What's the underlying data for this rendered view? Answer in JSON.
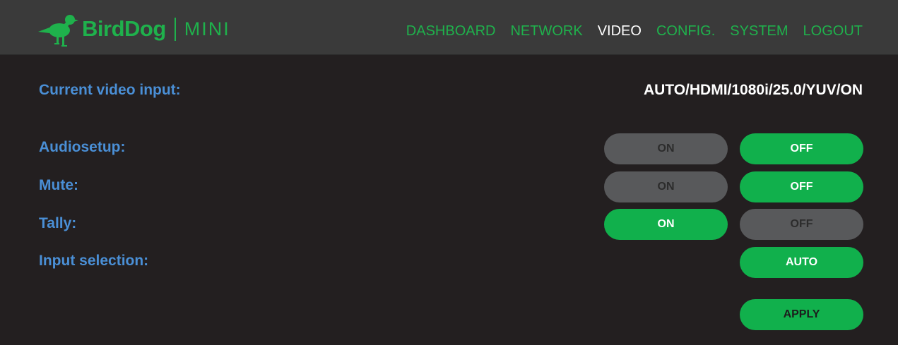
{
  "brand": {
    "name": "BirdDog",
    "model": "MINI",
    "color": "#1fb14c"
  },
  "nav": {
    "items": [
      {
        "label": "DASHBOARD",
        "active": false
      },
      {
        "label": "NETWORK",
        "active": false
      },
      {
        "label": "VIDEO",
        "active": true
      },
      {
        "label": "CONFIG.",
        "active": false
      },
      {
        "label": "SYSTEM",
        "active": false
      },
      {
        "label": "LOGOUT",
        "active": false
      }
    ]
  },
  "video": {
    "current_input_label": "Current video input:",
    "current_input_value": "AUTO/HDMI/1080i/25.0/YUV/ON",
    "audiosetup": {
      "label": "Audiosetup:",
      "on_label": "ON",
      "off_label": "OFF",
      "selected": "OFF"
    },
    "mute": {
      "label": "Mute:",
      "on_label": "ON",
      "off_label": "OFF",
      "selected": "OFF"
    },
    "tally": {
      "label": "Tally:",
      "on_label": "ON",
      "off_label": "OFF",
      "selected": "ON"
    },
    "input_selection": {
      "label": "Input selection:",
      "value": "AUTO"
    },
    "apply_label": "APPLY"
  },
  "colors": {
    "active_button": "#11b04c",
    "inactive_button": "#58595b",
    "label_blue": "#4a8fd6",
    "background": "#231f20",
    "header": "#3a3a3a"
  }
}
